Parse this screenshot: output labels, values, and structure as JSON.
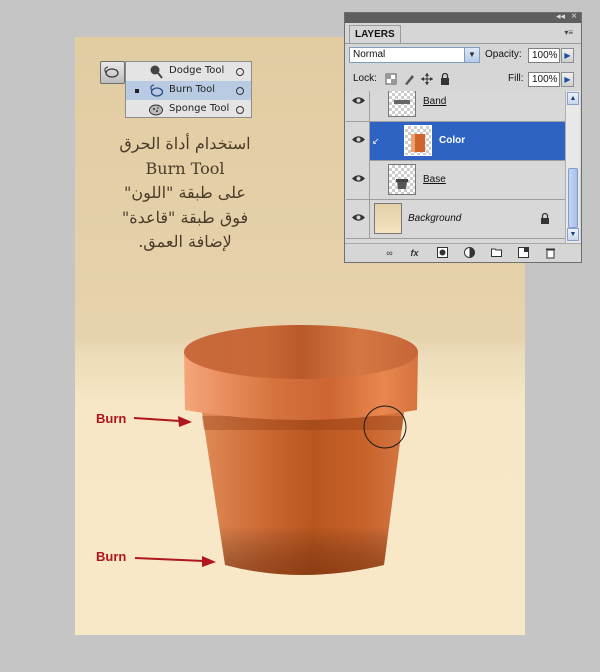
{
  "tool_flyout": {
    "items": [
      {
        "label": "Dodge Tool",
        "icon": "dodge-tool-icon",
        "selected": false
      },
      {
        "label": "Burn Tool",
        "icon": "burn-tool-icon",
        "selected": true
      },
      {
        "label": "Sponge Tool",
        "icon": "sponge-tool-icon",
        "selected": false
      }
    ]
  },
  "caption": {
    "lines": [
      "استخدام أداة الحرق",
      "Burn Tool",
      "على طبقة \"اللون\"",
      "فوق طبقة \"قاعدة\"",
      "لإضافة العمق."
    ]
  },
  "annotations": {
    "burn_label_1": "Burn",
    "burn_label_2": "Burn"
  },
  "layers_panel": {
    "tab": "LAYERS",
    "blend_mode": "Normal",
    "opacity_label": "Opacity:",
    "opacity_value": "100%",
    "lock_label": "Lock:",
    "fill_label": "Fill:",
    "fill_value": "100%",
    "layers": [
      {
        "name": "Band",
        "selected": false,
        "italic": false
      },
      {
        "name": "Color",
        "selected": true,
        "italic": false,
        "clipped": true
      },
      {
        "name": "Base",
        "selected": false,
        "italic": false
      },
      {
        "name": "Background",
        "selected": false,
        "italic": true,
        "locked": true
      }
    ]
  },
  "colors": {
    "selection": "#2f63c3",
    "annotation_red": "#b0161c",
    "pot_base": "#c8622e"
  }
}
